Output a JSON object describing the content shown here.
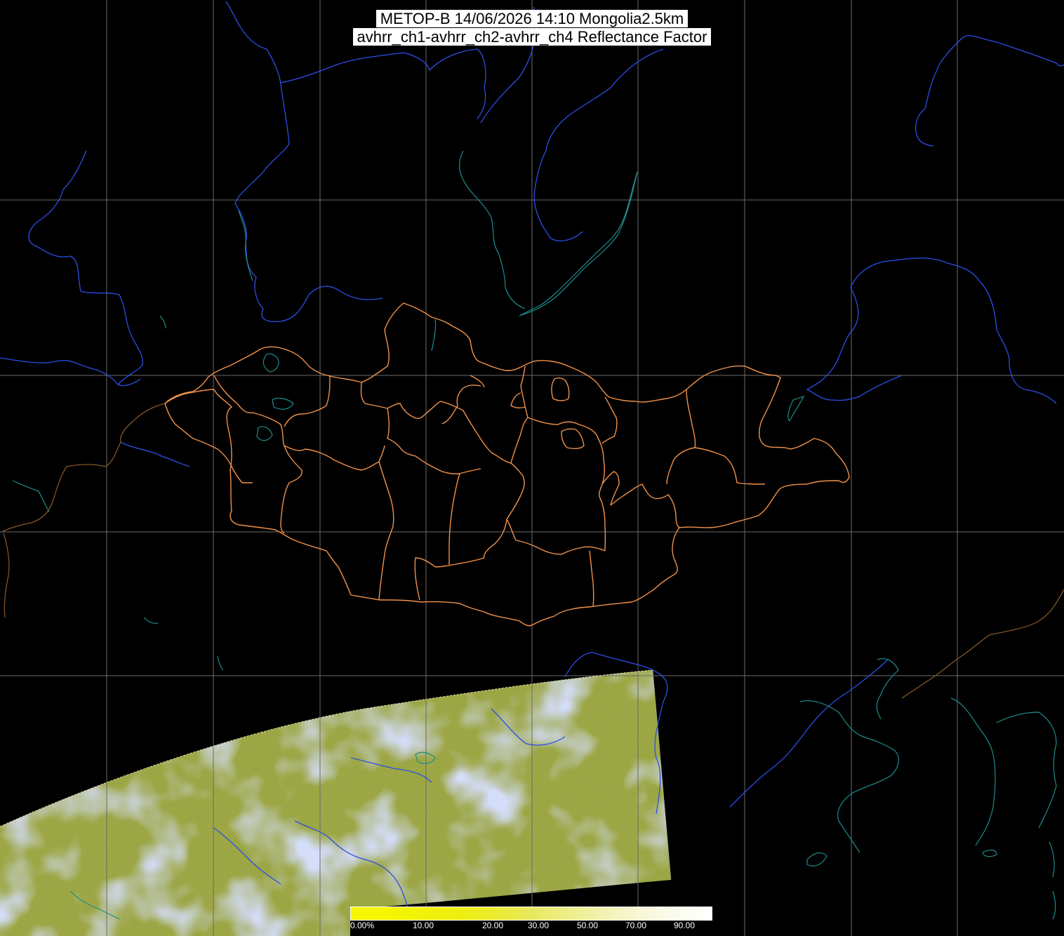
{
  "title": {
    "line1": "METOP-B 14/06/2026 14:10 Mongolia2.5km",
    "line2": "avhrr_ch1-avhrr_ch2-avhrr_ch4 Reflectance Factor"
  },
  "colors": {
    "background": "#000000",
    "grid": "#6a6a6a",
    "rivers": "#2a4de0",
    "coast_lakes": "#1f8a8a",
    "provinces": "#f0924a",
    "swath_clear": "#8c9a2a",
    "swath_cloud": "#a8b4f0"
  },
  "colorbar": {
    "labels": [
      "0.00%",
      "10.00",
      "20.00",
      "30.00",
      "50.00",
      "70.00",
      "90.00"
    ]
  },
  "icons": [
    "map-grid",
    "colorbar"
  ]
}
